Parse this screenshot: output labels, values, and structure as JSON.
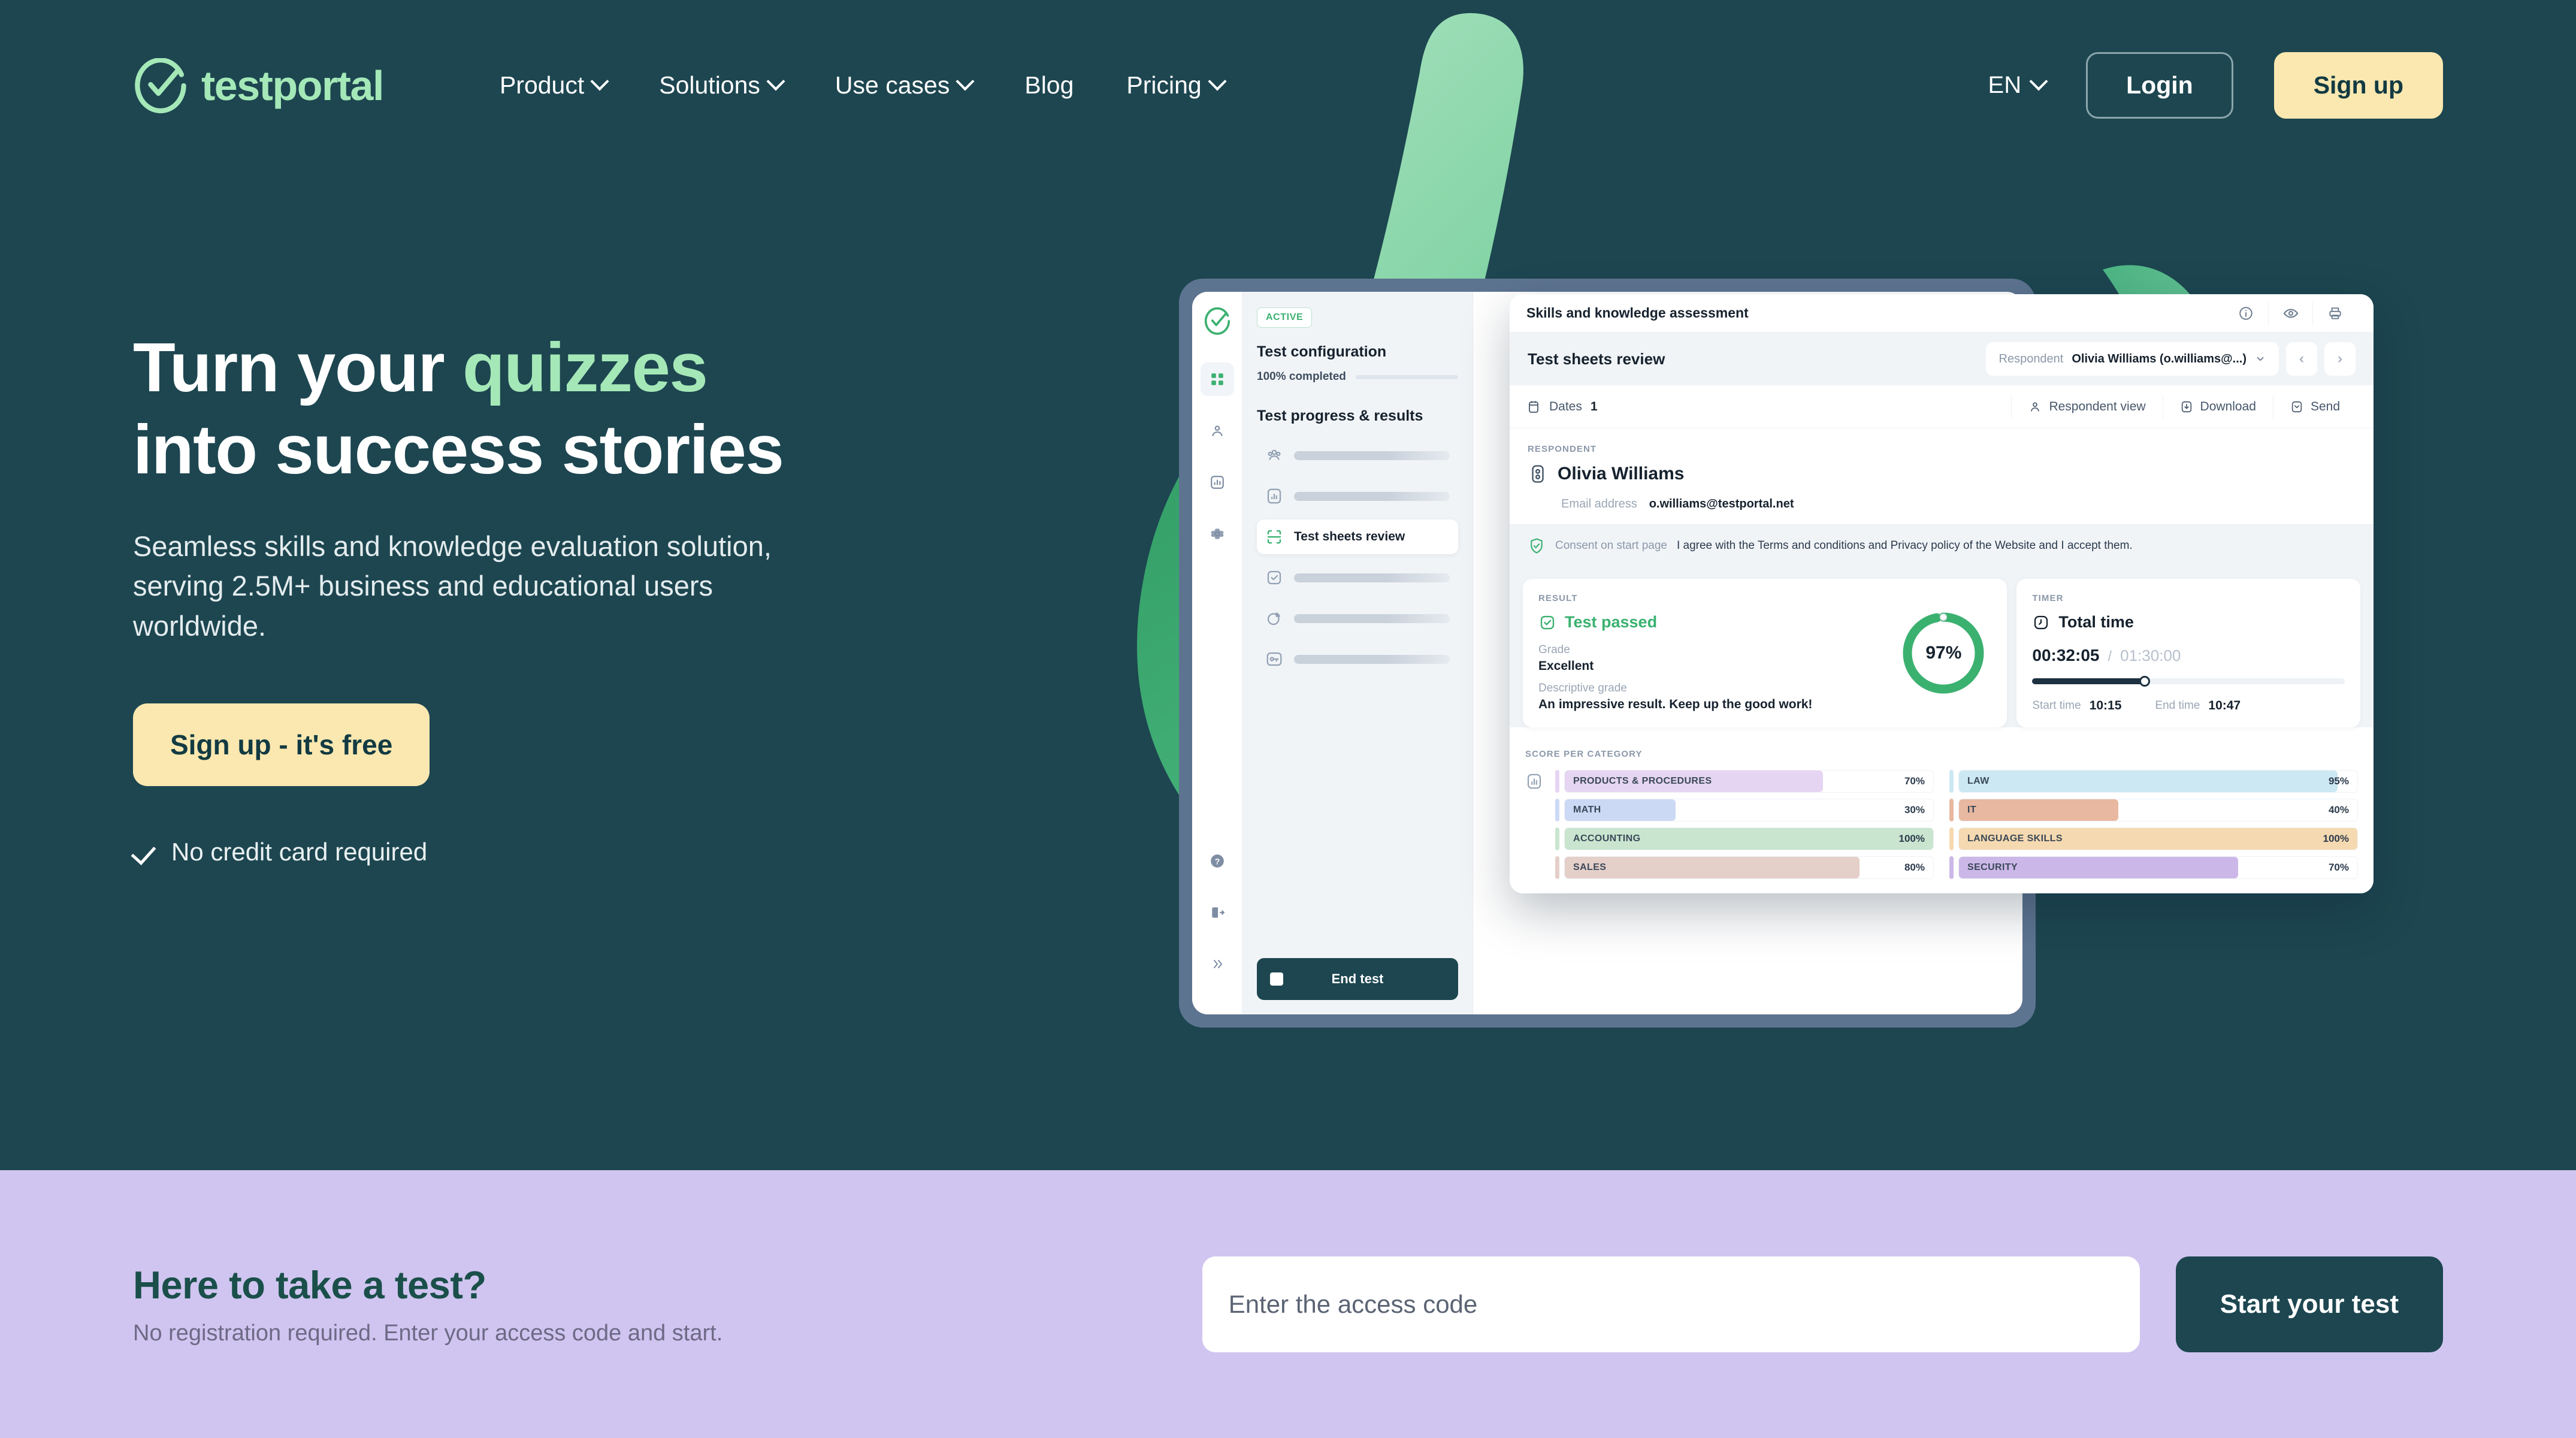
{
  "brand": {
    "name": "testportal",
    "logo_icon": "check-circle-logo"
  },
  "nav": {
    "items": [
      {
        "label": "Product",
        "has_dropdown": true
      },
      {
        "label": "Solutions",
        "has_dropdown": true
      },
      {
        "label": "Use cases",
        "has_dropdown": true
      },
      {
        "label": "Blog",
        "has_dropdown": false
      },
      {
        "label": "Pricing",
        "has_dropdown": true
      }
    ],
    "language": "EN",
    "login_label": "Login",
    "signup_label": "Sign up"
  },
  "hero": {
    "title_part1": "Turn your",
    "title_highlight": "quizzes",
    "title_part2": "into success stories",
    "subtitle": "Seamless skills and knowledge evaluation solution, serving 2.5M+ business and educational users worldwide.",
    "cta_label": "Sign up - it's free",
    "note": "No credit card required"
  },
  "app": {
    "window_title": "Skills and knowledge assessment",
    "topbar_icons": [
      "info-icon",
      "eye-icon",
      "print-icon"
    ],
    "sidebar": {
      "status_badge": "ACTIVE",
      "config_heading": "Test configuration",
      "progress_label": "100% completed",
      "progress_value": 100,
      "results_heading": "Test progress & results",
      "items": [
        {
          "label": "",
          "icon": "people-icon",
          "active": false
        },
        {
          "label": "",
          "icon": "bar-chart-icon",
          "active": false
        },
        {
          "label": "Test sheets review",
          "icon": "scan-icon",
          "active": true
        },
        {
          "label": "",
          "icon": "check-square-icon",
          "active": false
        },
        {
          "label": "",
          "icon": "pie-chart-icon",
          "active": false
        },
        {
          "label": "",
          "icon": "key-icon",
          "active": false
        }
      ],
      "end_test_label": "End test",
      "rail_icons": [
        "grid-icon",
        "people-icon",
        "bar-chart-icon",
        "gear-icon"
      ],
      "rail_bottom_icons": [
        "help-icon",
        "logout-icon",
        "expand-icon"
      ]
    },
    "panel": {
      "section_title": "Test sheets review",
      "respondent_select_label": "Respondent",
      "respondent_select_value": "Olivia Williams (o.williams@...)",
      "prev_label": "‹",
      "next_label": "›",
      "toolbar": {
        "dates_label": "Dates",
        "dates_value": "1",
        "respondent_view_label": "Respondent view",
        "download_label": "Download",
        "send_label": "Send"
      },
      "respondent": {
        "kicker": "RESPONDENT",
        "name": "Olivia Williams",
        "email_label": "Email address",
        "email_value": "o.williams@testportal.net",
        "consent_label": "Consent on start page",
        "consent_text": "I agree with the Terms and conditions and Privacy policy of the Website and I accept them."
      },
      "result": {
        "kicker": "RESULT",
        "status": "Test passed",
        "grade_label": "Grade",
        "grade_value": "Excellent",
        "descriptive_label": "Descriptive grade",
        "descriptive_value": "An impressive result. Keep up the good work!",
        "score_percent": "97%"
      },
      "timer": {
        "kicker": "TIMER",
        "title": "Total time",
        "elapsed": "00:32:05",
        "separator": "/",
        "limit": "01:30:00",
        "start_label": "Start time",
        "start_value": "10:15",
        "end_label": "End time",
        "end_value": "10:47"
      },
      "score_per_category": {
        "kicker": "SCORE PER CATEGORY",
        "left": [
          {
            "name": "PRODUCTS & PROCEDURES",
            "percent": "70%",
            "value": 70,
            "color": "#e5d5f2"
          },
          {
            "name": "MATH",
            "percent": "30%",
            "value": 30,
            "color": "#ccd9f5"
          },
          {
            "name": "ACCOUNTING",
            "percent": "100%",
            "value": 100,
            "color": "#c9e5cf"
          },
          {
            "name": "SALES",
            "percent": "80%",
            "value": 80,
            "color": "#e5cfc9"
          }
        ],
        "right": [
          {
            "name": "LAW",
            "percent": "95%",
            "value": 95,
            "color": "#cce8f2"
          },
          {
            "name": "IT",
            "percent": "40%",
            "value": 40,
            "color": "#e8b8a0"
          },
          {
            "name": "LANGUAGE SKILLS",
            "percent": "100%",
            "value": 100,
            "color": "#f5d9b0"
          },
          {
            "name": "SECURITY",
            "percent": "70%",
            "value": 70,
            "color": "#ccb8e8"
          }
        ]
      }
    }
  },
  "band": {
    "title": "Here to take a test?",
    "subtitle": "No registration required. Enter your access code and start.",
    "input_placeholder": "Enter the access code",
    "input_value": "",
    "button_label": "Start your test"
  },
  "colors": {
    "hero_bg": "#1d4650",
    "accent_green": "#a5e8b8",
    "cta_yellow": "#fae8b0",
    "band_bg": "#d0c5f0",
    "band_title": "#1a4f4a",
    "pass_green": "#3bb170"
  }
}
